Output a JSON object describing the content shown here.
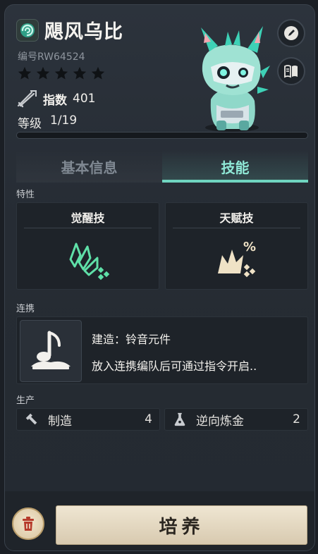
{
  "pal": {
    "name": "飓风乌比",
    "serial": "编号RW64524",
    "stars": 5,
    "index_label": "指数",
    "index_value": "401",
    "level_label": "等级",
    "level_value": "1/19",
    "level_progress": 0.0
  },
  "tabs": [
    {
      "label": "基本信息",
      "active": false
    },
    {
      "label": "技能",
      "active": true
    }
  ],
  "traits": {
    "section_label": "特性",
    "awaken_title": "觉醒技",
    "talent_title": "天赋技"
  },
  "link": {
    "section_label": "连携",
    "title": "建造：铃音元件",
    "description": "放入连携编队后可通过指令开启.."
  },
  "production": {
    "section_label": "生产",
    "items": [
      {
        "name": "制造",
        "count": "4",
        "icon": "hammer-icon"
      },
      {
        "name": "逆向炼金",
        "count": "2",
        "icon": "flask-icon"
      }
    ]
  },
  "actions": {
    "train_label": "培养",
    "release_icon": "trash-icon"
  },
  "colors": {
    "accent": "#6fd5c0",
    "awaken_icon": "#5fe0a8",
    "talent_icon": "#efe2c6",
    "train_button": "#efe6d2"
  }
}
